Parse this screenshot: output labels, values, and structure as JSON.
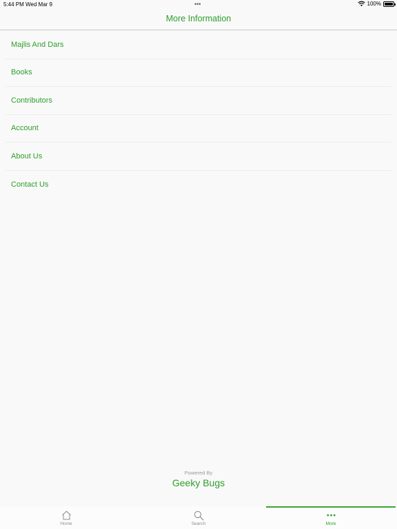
{
  "status_bar": {
    "time": "5:44 PM",
    "date": "Wed Mar 9",
    "dots": "•••",
    "battery": "100%"
  },
  "nav": {
    "title": "More Information"
  },
  "menu": {
    "items": [
      {
        "label": "Majlis And Dars"
      },
      {
        "label": "Books"
      },
      {
        "label": "Contributors"
      },
      {
        "label": "Account"
      },
      {
        "label": "About Us"
      },
      {
        "label": "Contact Us"
      }
    ]
  },
  "footer": {
    "powered_by": "Powered By",
    "company": "Geeky Bugs"
  },
  "tabs": [
    {
      "label": "Home",
      "icon": "home-icon"
    },
    {
      "label": "Search",
      "icon": "search-icon"
    },
    {
      "label": "More",
      "icon": "more-icon",
      "active": true
    }
  ],
  "colors": {
    "accent": "#2e9e2a",
    "background": "#f9f9f9",
    "inactive": "#8e8e8e"
  }
}
